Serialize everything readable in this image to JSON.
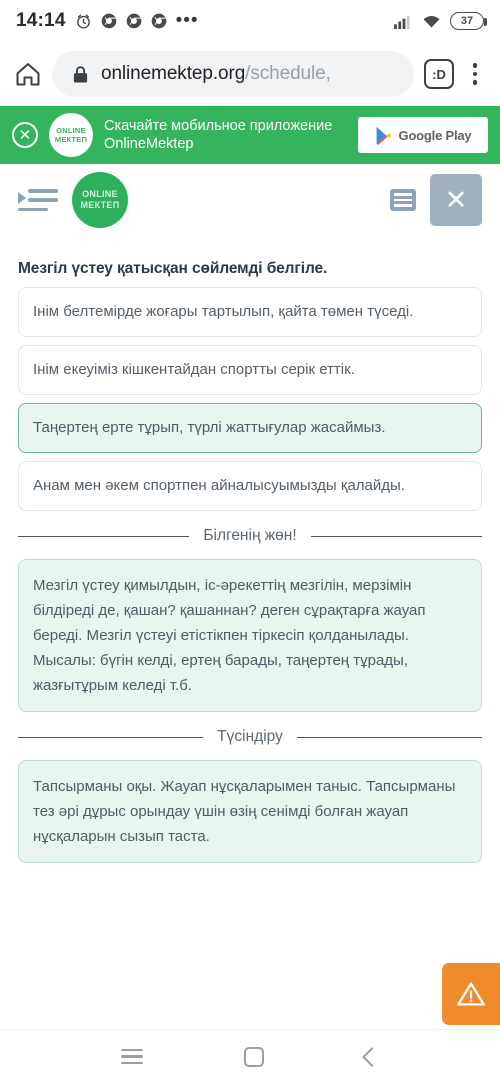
{
  "status_bar": {
    "time": "14:14",
    "icons": [
      "alarm-clock-icon",
      "chrome-icon",
      "chrome-icon",
      "chrome-icon",
      "overflow-dots-icon"
    ],
    "signal_icon": "cellular-signal-icon",
    "wifi_icon": "wifi-icon",
    "battery_level": "37"
  },
  "browser": {
    "home_icon": "home-icon",
    "lock_icon": "lock-icon",
    "url_domain": "onlinemektep.org",
    "url_path": "/schedule,",
    "emoji_label": ":D",
    "menu_icon": "kebab-menu-icon"
  },
  "promo": {
    "close_icon": "close-circle-icon",
    "logo_line1": "ONLINE",
    "logo_line2": "МЕКТЕП",
    "text_line1": "Скачайте мобильное приложение",
    "text_line2": "OnlineMektep",
    "store_button_label": "Google Play",
    "background_color": "#35b45e"
  },
  "site_header": {
    "menu_icon": "indent-menu-icon",
    "logo_line1": "ONLINE",
    "logo_line2": "МЕКТЕП",
    "list_icon": "list-view-icon",
    "close_label": "✕"
  },
  "question": {
    "title": "Мезгіл үстеу қатысқан сөйлемді белгіле.",
    "options": [
      {
        "text": "Інім белтемірде жоғары тартылып, қайта төмен түседі.",
        "selected": false
      },
      {
        "text": "Інім екеуіміз кішкентайдан спортты серік еттік.",
        "selected": false
      },
      {
        "text": "Таңертең ерте тұрып, түрлі жаттығулар жасаймыз.",
        "selected": true
      },
      {
        "text": "Анам мен әкем спортпен айналысуымызды қалайды.",
        "selected": false
      }
    ]
  },
  "know_section": {
    "divider_label": "Білгенің жөн!",
    "body": "Мезгіл үстеу қимылдын, іс-әрекеттің мезгілін, мерзімін білдіреді де, қашан? қашаннан? деген сұрақтарға жауап береді. Мезгіл үстеуі етістікпен тіркесіп қолданылады. Мысалы: бүгін келді, ертең барады, таңертең тұрады, жазғытұрым келеді т.б."
  },
  "explain_section": {
    "divider_label": "Түсіндіру",
    "body": "Тапсырманы оқы. Жауап нұсқаларымен таныс. Тапсырманы тез әрі дұрыс орындау үшін өзің сенімді болған жауап нұсқаларын сызып таста."
  },
  "warning_button": {
    "icon": "warning-triangle-icon",
    "color": "#ef8b2c"
  },
  "android_nav": {
    "recents_icon": "recents-icon",
    "home_icon": "home-square-icon",
    "back_icon": "back-chevron-icon"
  },
  "colors": {
    "brand_green": "#2cb05c",
    "selected_bg": "#e9f5ef",
    "selected_border": "#64bd9b",
    "warning_orange": "#ef8b2c"
  }
}
